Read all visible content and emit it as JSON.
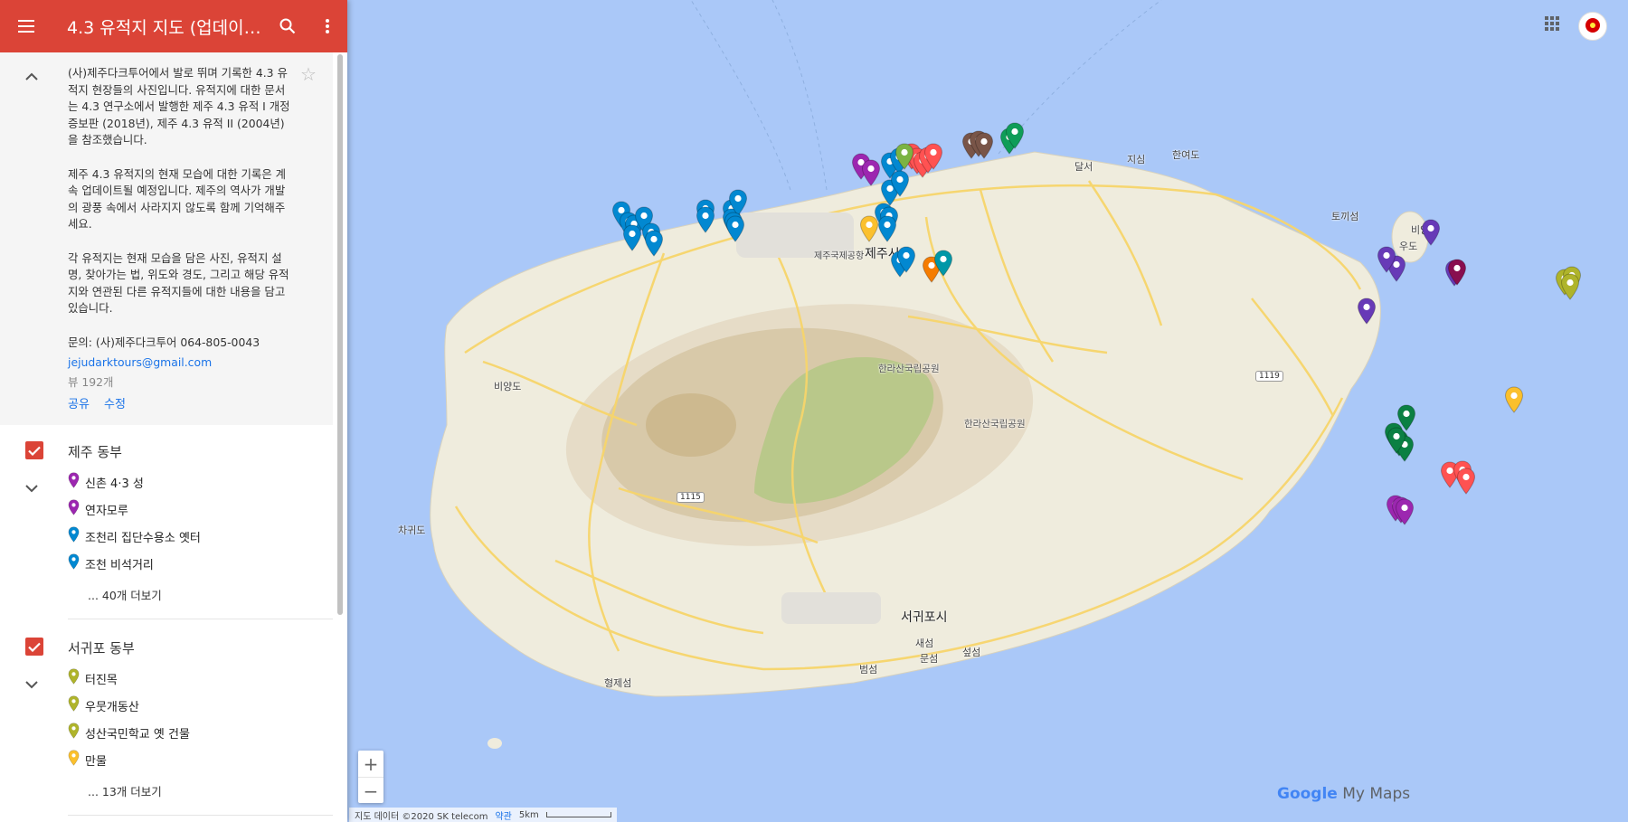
{
  "header": {
    "title": "4.3 유적지 지도 (업데이…"
  },
  "description": {
    "text": "(사)제주다크투어에서 발로 뛰며 기록한 4.3 유적지 현장들의 사진입니다. 유적지에 대한 문서는 4.3 연구소에서 발행한 제주 4.3 유적 I 개정증보판 (2018년), 제주 4.3 유적 II (2004년)을 참조했습니다.\n\n제주 4.3 유적지의 현재 모습에 대한 기록은 계속 업데이트될 예정입니다. 제주의 역사가 개발의 광풍 속에서 사라지지 않도록 함께 기억해주세요.\n\n각 유적지는 현재 모습을 담은 사진, 유적지 설명, 찾아가는 법, 위도와 경도, 그리고 해당 유적지와 연관된 다른 유적지들에 대한 내용을 담고 있습니다.\n\n문의: (사)제주다크투어 064-805-0043",
    "email": "jejudarktours@gmail.com",
    "views": "뷰 192개",
    "share": "공유",
    "edit": "수정"
  },
  "layers": [
    {
      "title": "제주 동부",
      "items": [
        {
          "label": "신촌 4·3 성",
          "color": "#9c27b0"
        },
        {
          "label": "연자모루",
          "color": "#9c27b0"
        },
        {
          "label": "조천리 집단수용소 옛터",
          "color": "#0288d1"
        },
        {
          "label": "조천 비석거리",
          "color": "#0288d1"
        }
      ],
      "more": "... 40개 더보기"
    },
    {
      "title": "서귀포 동부",
      "items": [
        {
          "label": "터진목",
          "color": "#afb42b"
        },
        {
          "label": "우뭇개동산",
          "color": "#afb42b"
        },
        {
          "label": "성산국민학교 옛 건물",
          "color": "#afb42b"
        },
        {
          "label": "만물",
          "color": "#fbc02d"
        }
      ],
      "more": "... 13개 더보기"
    }
  ],
  "map": {
    "labels": {
      "jeju_city": "제주시",
      "airport": "제주국제공항",
      "seogwipo": "서귀포시",
      "hallasan1": "한라산국립공원",
      "hallasan2": "한라산국립공원",
      "biyangdo_w": "비양도",
      "chagwido": "차귀도",
      "hyeongjeseom": "형제섬",
      "beomseom": "범섬",
      "saeseom": "새섬",
      "munseom": "문섬",
      "seopseom": "섶섬",
      "hanyeodo": "한여도",
      "tokkiseom": "토끼섬",
      "biyangdo_e": "비양도",
      "udo": "우도",
      "dalseo": "달서",
      "jisim": "지심",
      "r1115": "1115",
      "r1119": "1119"
    },
    "attribution": {
      "data": "지도 데이터 ©2020 SK telecom",
      "terms": "약관",
      "scale": "5km"
    },
    "brand": {
      "google": "Google",
      "mymaps": "My Maps"
    },
    "zoom_in": "+",
    "zoom_out": "−",
    "pin_colors": {
      "blue": "#0288d1",
      "purple": "#9c27b0",
      "deep_purple": "#673ab7",
      "red": "#ff5252",
      "brown": "#795548",
      "green": "#0f9d58",
      "dark_green": "#0b8043",
      "olive": "#afb42b",
      "yellow": "#fbc02d",
      "orange": "#f57c00",
      "teal": "#0097a7",
      "maroon": "#880e4f",
      "lime": "#7cb342"
    }
  }
}
